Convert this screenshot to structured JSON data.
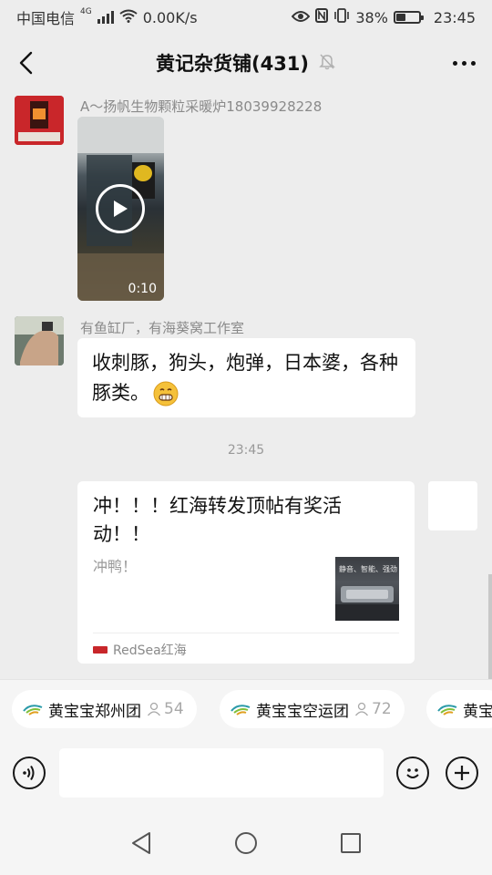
{
  "status_bar": {
    "carrier": "中国电信",
    "network": "4G",
    "speed": "0.00K/s",
    "battery": "38%",
    "battery_level": 0.38,
    "time": "23:45"
  },
  "header": {
    "title": "黄记杂货铺(431)"
  },
  "messages": [
    {
      "type": "video",
      "sender": "A～扬帆生物颗粒采暖炉18039928228",
      "duration": "0:10"
    },
    {
      "type": "text",
      "sender": "有鱼缸厂，有海葵窝工作室",
      "text": "收刺豚，狗头，炮弹，日本婆，各种豚类。"
    },
    {
      "type": "time",
      "text": "23:45"
    },
    {
      "type": "link",
      "title": "冲！！！红海转发顶帖有奖活动！！",
      "desc": "冲鸭！",
      "thumb_text": "静音、智能、强劲",
      "source": "RedSea红海"
    }
  ],
  "groups": [
    {
      "name": "黄宝宝郑州团",
      "count": "54"
    },
    {
      "name": "黄宝宝空运团",
      "count": "72"
    },
    {
      "name": "黄宝",
      "count": ""
    }
  ],
  "colors": {
    "background": "#ededed",
    "bubble": "#ffffff",
    "muted_text": "#8a8a8a",
    "avatar_red": "#c9262a"
  },
  "icons": {
    "back": "chevron-left-icon",
    "mute": "bell-off-icon",
    "more": "more-dots-icon",
    "voice": "voice-icon",
    "emoji": "smiley-icon",
    "plus": "plus-icon",
    "group_member": "person-icon",
    "nav_back": "triangle-back-icon",
    "nav_home": "circle-home-icon",
    "nav_recent": "square-recent-icon"
  }
}
